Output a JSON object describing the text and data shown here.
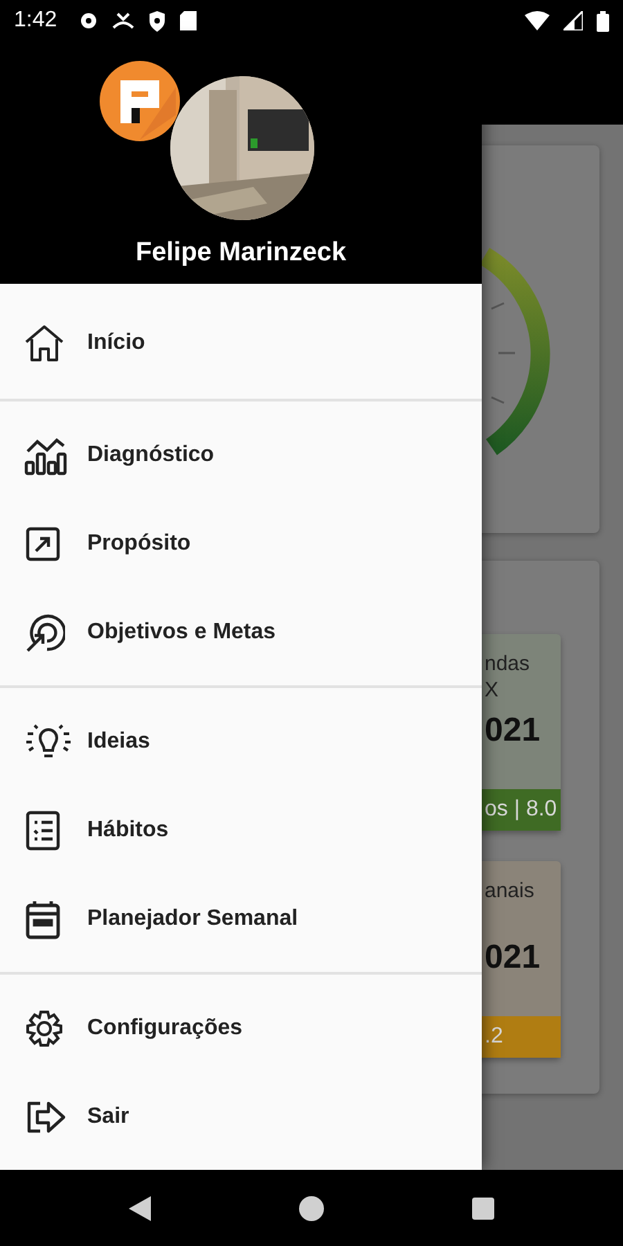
{
  "status_bar": {
    "time": "1:42"
  },
  "drawer": {
    "profile": {
      "name": "Felipe Marinzeck"
    },
    "groups": [
      {
        "items": [
          {
            "label": "Início"
          }
        ]
      },
      {
        "items": [
          {
            "label": "Diagnóstico"
          },
          {
            "label": "Propósito"
          },
          {
            "label": "Objetivos e Metas"
          }
        ]
      },
      {
        "items": [
          {
            "label": "Ideias"
          },
          {
            "label": "Hábitos"
          },
          {
            "label": "Planejador Semanal"
          }
        ]
      },
      {
        "items": [
          {
            "label": "Configurações"
          },
          {
            "label": "Sair"
          }
        ]
      }
    ]
  },
  "background": {
    "cards": [
      {
        "title_lines": [
          "ndas",
          "X"
        ],
        "value": "021",
        "footer": "os | 8.0",
        "color": "#3f6b24"
      },
      {
        "title_lines": [
          "anais"
        ],
        "value": "021",
        "footer": ".2",
        "color": "#b07d12"
      }
    ]
  }
}
